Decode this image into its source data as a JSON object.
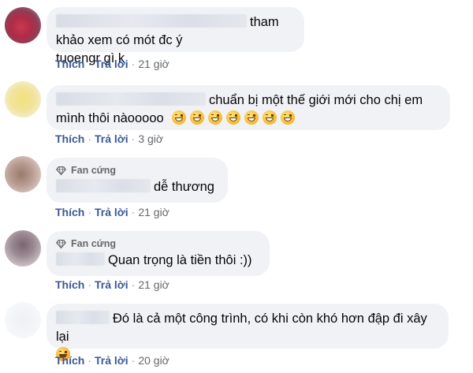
{
  "comments": [
    {
      "text": "tham khảo xem có mót đc ý tuoengr gì k",
      "line1": "tham khảo xem có mót đc ý",
      "line2": "tuoengr gì k",
      "badge": "",
      "actions": {
        "like": "Thích",
        "reply": "Trả lời",
        "time": "21 giờ"
      }
    },
    {
      "text": "chuẩn bị một thế giới mới cho chị em mình thôi nàooooo",
      "line1": "chuẩn bị một thế giới mới cho chị em",
      "line2": "mình thôi nàooooo",
      "emoji_count": 7,
      "badge": "",
      "actions": {
        "like": "Thích",
        "reply": "Trả lời",
        "time": "3 giờ"
      }
    },
    {
      "text": "dễ thương",
      "badge": "Fan cứng",
      "actions": {
        "like": "Thích",
        "reply": "Trả lời",
        "time": "21 giờ"
      }
    },
    {
      "text": "Quan trọng là tiền thôi :))",
      "badge": "Fan cứng",
      "actions": {
        "like": "Thích",
        "reply": "Trả lời",
        "time": "21 giờ"
      }
    },
    {
      "text": "Đó là cả một công trình, có khi còn khó hơn đập đi xây lại",
      "badge": "",
      "actions": {
        "like": "Thích",
        "reply": "Trả lời",
        "time": "20 giờ"
      }
    }
  ],
  "colors": {
    "bubble": "#f0f2f5",
    "link": "#3b5998",
    "meta": "#65676b"
  },
  "icons": {
    "badge": "diamond-icon",
    "emoji_grin": "grinning-face-icon",
    "emoji_tears": "face-with-tears-of-joy-icon"
  }
}
